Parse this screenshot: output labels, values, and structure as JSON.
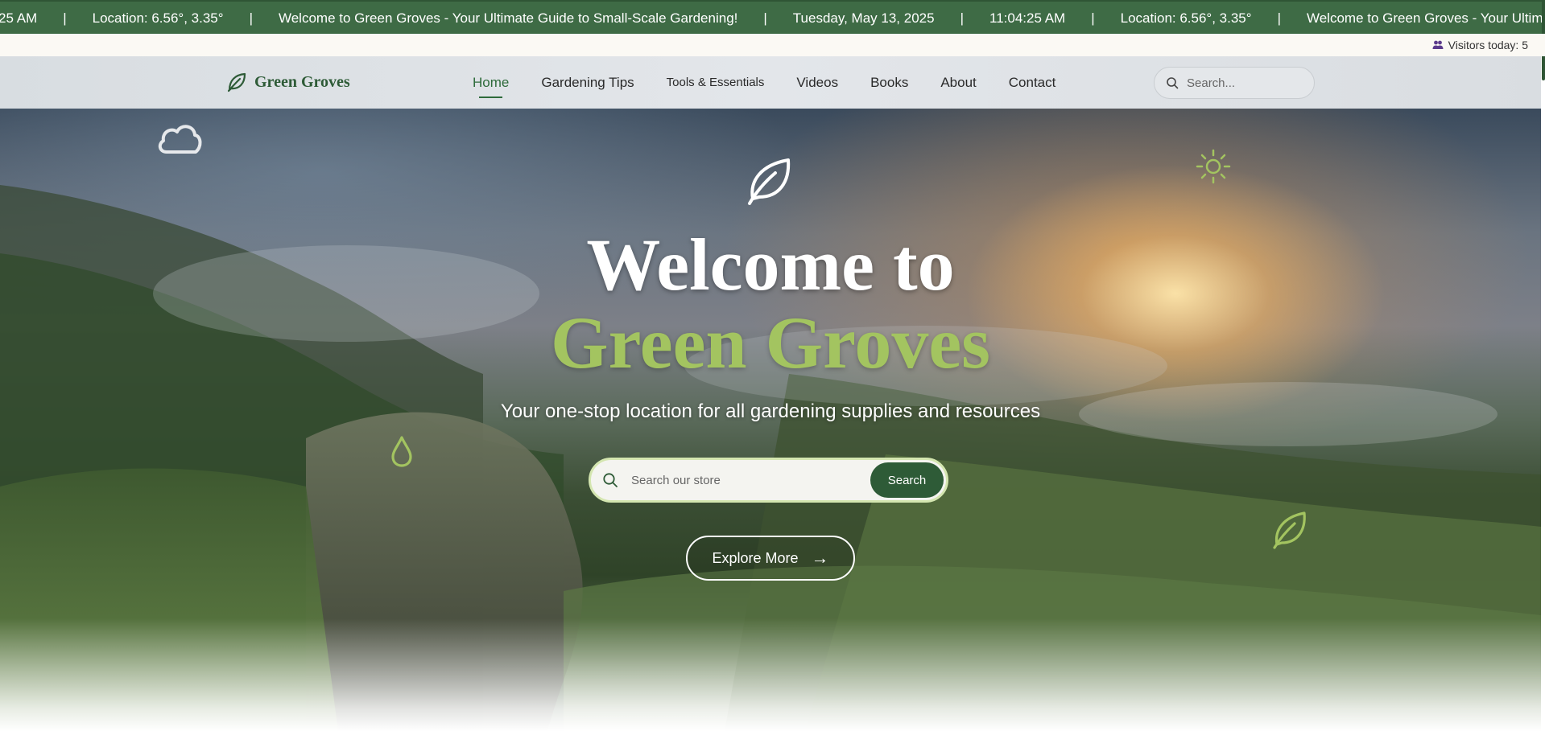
{
  "ticker": {
    "items": [
      "25 AM",
      "Location: 6.56°, 3.35°",
      "Welcome to Green Groves - Your Ultimate Guide to Small-Scale Gardening!",
      "Tuesday, May 13, 2025",
      "11:04:25 AM",
      "Location: 6.56°, 3.35°",
      "Welcome to Green Groves - Your Ultimate Guide to S"
    ],
    "separator": "|"
  },
  "visitors": {
    "label": "Visitors today: 5",
    "icon": "users-icon"
  },
  "nav": {
    "logo_text": "Green Groves",
    "logo_icon": "leaf-icon",
    "links": [
      {
        "label": "Home",
        "active": true
      },
      {
        "label": "Gardening Tips"
      },
      {
        "label": "Tools & Essentials"
      },
      {
        "label": "Videos"
      },
      {
        "label": "Books"
      },
      {
        "label": "About"
      },
      {
        "label": "Contact"
      }
    ],
    "search_placeholder": "Search..."
  },
  "hero": {
    "title_line1": "Welcome to",
    "title_line2": "Green Groves",
    "subtitle": "Your one-stop location for all gardening supplies and resources",
    "search_placeholder": "Search our store",
    "search_button": "Search",
    "explore_label": "Explore More",
    "explore_arrow": "→"
  },
  "colors": {
    "brand_green": "#2e5b37",
    "accent_green": "#a3c460",
    "ticker_bg": "#3e6b45"
  }
}
